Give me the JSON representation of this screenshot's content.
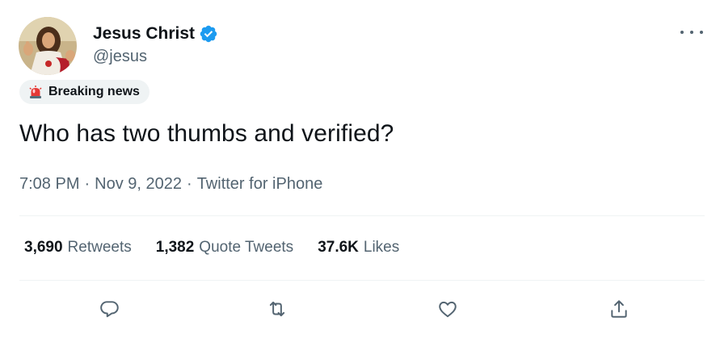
{
  "author": {
    "display_name": "Jesus Christ",
    "handle": "@jesus",
    "verified": true,
    "avatar_icon": "avatar-photo"
  },
  "label": {
    "icon": "siren-icon",
    "text": "Breaking news"
  },
  "tweet": {
    "text": "Who has two thumbs and verified?"
  },
  "meta": {
    "time": "7:08 PM",
    "separator": "·",
    "date": "Nov 9, 2022",
    "source": "Twitter for iPhone"
  },
  "stats": [
    {
      "count": "3,690",
      "label": "Retweets"
    },
    {
      "count": "1,382",
      "label": "Quote Tweets"
    },
    {
      "count": "37.6K",
      "label": "Likes"
    }
  ],
  "actions": [
    "reply-icon",
    "retweet-icon",
    "like-icon",
    "share-icon"
  ],
  "colors": {
    "accent": "#1d9bf0",
    "text": "#0f1419",
    "secondary": "#536471",
    "divider": "#eff3f4"
  }
}
